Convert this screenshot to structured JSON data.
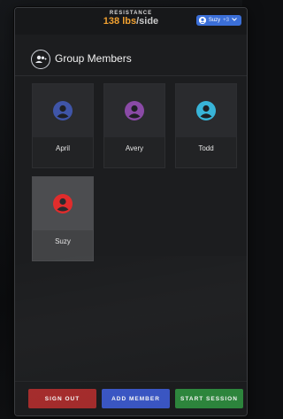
{
  "topbar": {
    "resistance_label": "RESISTANCE",
    "resistance_value": "138 lbs",
    "resistance_unit": "/side",
    "user_name": "Suzy",
    "user_extra": "+3"
  },
  "header": {
    "title": "Group Members"
  },
  "members": [
    {
      "name": "April",
      "color": "#3f55a8"
    },
    {
      "name": "Avery",
      "color": "#8a4aa6"
    },
    {
      "name": "Todd",
      "color": "#38b4d8"
    },
    {
      "name": "Suzy",
      "color": "#e02c2c",
      "selected": true
    }
  ],
  "footer": {
    "sign_out": "SIGN OUT",
    "add_member": "ADD MEMBER",
    "start_session": "START SESSION"
  },
  "colors": {
    "accent_orange": "#f0a030",
    "pill_blue": "#3b6fd8",
    "sign_out_red": "#a82c2c",
    "add_member_blue": "#3b58c9",
    "start_session_green": "#2e8a3e"
  }
}
